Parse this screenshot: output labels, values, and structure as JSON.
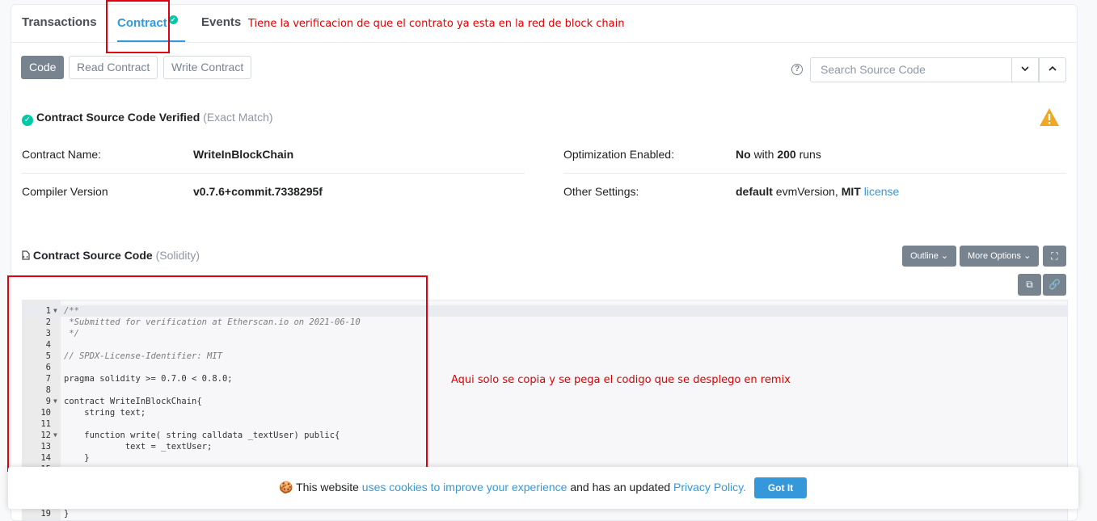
{
  "tabs": {
    "transactions": "Transactions",
    "contract": "Contract",
    "events": "Events"
  },
  "annotations": {
    "top": "Tiene la verificacion de que el contrato ya esta en la red de block chain",
    "code": "Aqui solo se copia y se pega el codigo que se desplego en remix"
  },
  "subtabs": {
    "code": "Code",
    "read": "Read Contract",
    "write": "Write Contract"
  },
  "search": {
    "placeholder": "Search Source Code"
  },
  "verified": {
    "title": "Contract Source Code Verified",
    "match": "(Exact Match)"
  },
  "info": {
    "name_label": "Contract Name:",
    "name_value": "WriteInBlockChain",
    "compiler_label": "Compiler Version",
    "compiler_value": "v0.7.6+commit.7338295f",
    "opt_label": "Optimization Enabled:",
    "opt_no": "No",
    "opt_with": "with",
    "opt_runs": "200",
    "opt_runs_word": "runs",
    "other_label": "Other Settings:",
    "other_default": "default",
    "other_evm": "evmVersion,",
    "other_mit": "MIT",
    "other_license": "license"
  },
  "source": {
    "title": "Contract Source Code",
    "lang": "(Solidity)",
    "outline": "Outline",
    "more": "More Options"
  },
  "code_lines": [
    {
      "n": "1",
      "fold": true,
      "t": "/**",
      "c": "cm"
    },
    {
      "n": "2",
      "t": " *Submitted for verification at Etherscan.io on 2021-06-10",
      "c": "cm"
    },
    {
      "n": "3",
      "t": " */",
      "c": "cm"
    },
    {
      "n": "4",
      "t": ""
    },
    {
      "n": "5",
      "t": "// SPDX-License-Identifier: MIT",
      "c": "cm"
    },
    {
      "n": "6",
      "t": ""
    },
    {
      "n": "7",
      "t": "pragma solidity >= 0.7.0 < 0.8.0;"
    },
    {
      "n": "8",
      "t": ""
    },
    {
      "n": "9",
      "fold": true,
      "t": "contract WriteInBlockChain{"
    },
    {
      "n": "10",
      "t": "    string text;"
    },
    {
      "n": "11",
      "t": ""
    },
    {
      "n": "12",
      "fold": true,
      "t": "    function write( string calldata _textUser) public{"
    },
    {
      "n": "13",
      "t": "            text = _textUser;"
    },
    {
      "n": "14",
      "t": "    }"
    },
    {
      "n": "15",
      "t": ""
    },
    {
      "n": "19",
      "t": "}"
    }
  ],
  "cookie": {
    "pre": "This website",
    "link1": "uses cookies to improve your experience",
    "mid": "and has an updated",
    "link2": "Privacy Policy.",
    "button": "Got It"
  }
}
